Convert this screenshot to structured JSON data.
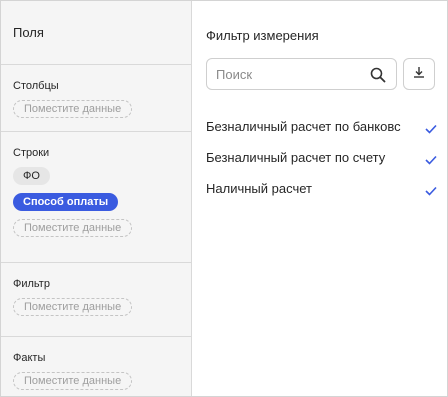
{
  "left": {
    "fields_label": "Поля",
    "drop_placeholder": "Поместите данные",
    "sections": {
      "columns": {
        "title": "Столбцы"
      },
      "rows": {
        "title": "Строки",
        "chips": [
          "ФО",
          "Способ оплаты"
        ]
      },
      "filter": {
        "title": "Фильтр"
      },
      "facts": {
        "title": "Факты"
      }
    }
  },
  "right": {
    "title": "Фильтр измерения",
    "search": {
      "placeholder": "Поиск",
      "value": ""
    },
    "items": [
      {
        "label": "Безналичный расчет по банковс",
        "checked": true
      },
      {
        "label": "Безналичный расчет по счету",
        "checked": true
      },
      {
        "label": "Наличный расчет",
        "checked": true
      }
    ]
  },
  "colors": {
    "accent": "#3a5be0",
    "panel_bg": "#f5f5f5",
    "check": "#3a5be0"
  }
}
